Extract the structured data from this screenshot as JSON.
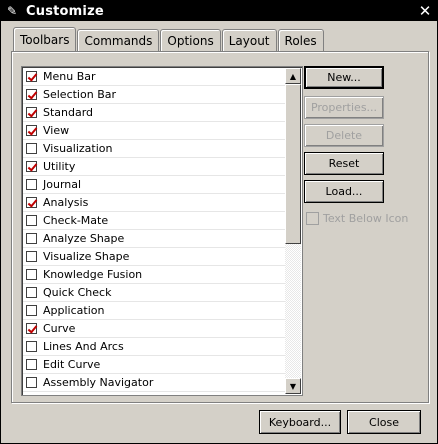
{
  "window": {
    "title": "Customize"
  },
  "tabs": [
    {
      "label": "Toolbars",
      "active": true
    },
    {
      "label": "Commands",
      "active": false
    },
    {
      "label": "Options",
      "active": false
    },
    {
      "label": "Layout",
      "active": false
    },
    {
      "label": "Roles",
      "active": false
    }
  ],
  "toolbars": [
    {
      "label": "Menu Bar",
      "checked": true
    },
    {
      "label": "Selection Bar",
      "checked": true
    },
    {
      "label": "Standard",
      "checked": true
    },
    {
      "label": "View",
      "checked": true
    },
    {
      "label": "Visualization",
      "checked": false
    },
    {
      "label": "Utility",
      "checked": true
    },
    {
      "label": "Journal",
      "checked": false
    },
    {
      "label": "Analysis",
      "checked": true
    },
    {
      "label": "Check-Mate",
      "checked": false
    },
    {
      "label": "Analyze Shape",
      "checked": false
    },
    {
      "label": "Visualize Shape",
      "checked": false
    },
    {
      "label": "Knowledge Fusion",
      "checked": false
    },
    {
      "label": "Quick Check",
      "checked": false
    },
    {
      "label": "Application",
      "checked": false
    },
    {
      "label": "Curve",
      "checked": true
    },
    {
      "label": "Lines And Arcs",
      "checked": false
    },
    {
      "label": "Edit Curve",
      "checked": false
    },
    {
      "label": "Assembly Navigator",
      "checked": false
    }
  ],
  "buttons": {
    "new_label": "New...",
    "properties_label": "Properties...",
    "delete_label": "Delete",
    "reset_label": "Reset",
    "load_label": "Load...",
    "text_below_icon_label": "Text Below Icon",
    "keyboard_label": "Keyboard...",
    "close_label": "Close"
  }
}
